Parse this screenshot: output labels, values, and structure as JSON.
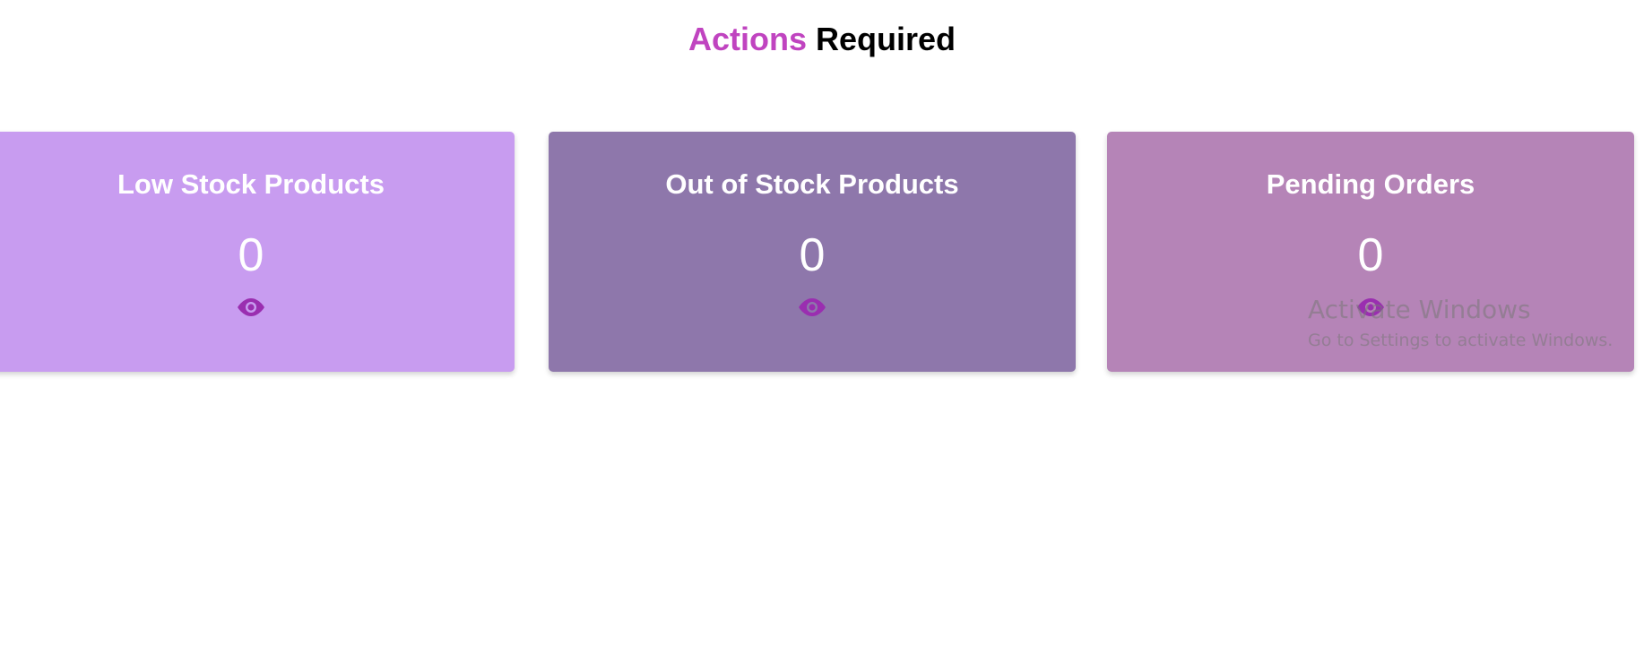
{
  "heading": {
    "accent": "Actions",
    "rest": "Required"
  },
  "cards": [
    {
      "title": "Low Stock Products",
      "count": "0",
      "icon": "eye-icon",
      "color": "#c89cf0"
    },
    {
      "title": "Out of Stock Products",
      "count": "0",
      "icon": "eye-icon",
      "color": "#8e77ab"
    },
    {
      "title": "Pending Orders",
      "count": "0",
      "icon": "eye-icon",
      "color": "#b584b7"
    }
  ],
  "colors": {
    "heading_accent": "#c044c0",
    "icon": "#9a2eb0"
  },
  "watermark": {
    "title": "Activate Windows",
    "subtitle": "Go to Settings to activate Windows."
  }
}
